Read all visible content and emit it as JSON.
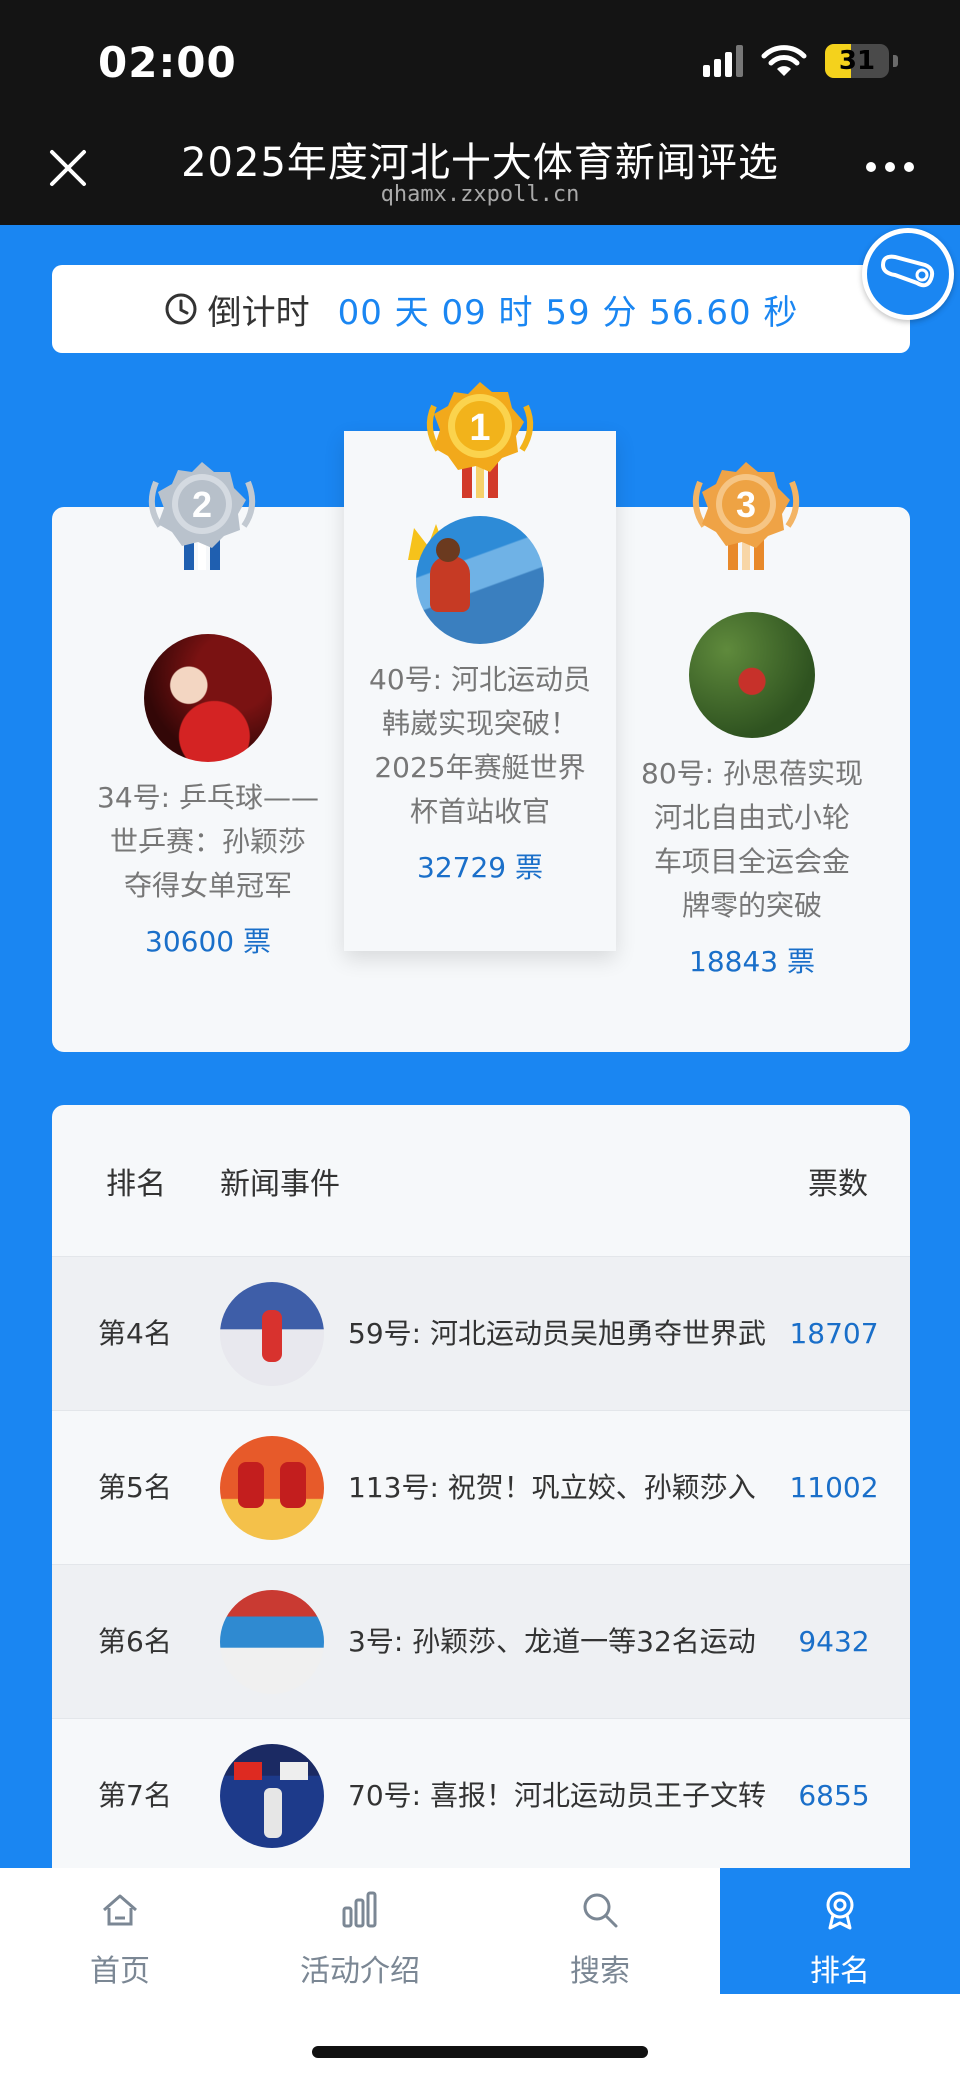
{
  "status_bar": {
    "time": "02:00",
    "battery": "31"
  },
  "header": {
    "title": "2025年度河北十大体育新闻评选",
    "host": "qhamx.zxpoll.cn"
  },
  "countdown": {
    "label": "倒计时",
    "value": "00 天 09 时 59 分 56.60 秒"
  },
  "podium": [
    {
      "place": "2",
      "title_lines": [
        "34号: 乒乓球——",
        "世乒赛：孙颖莎",
        "夺得女单冠军"
      ],
      "votes": "30600 票"
    },
    {
      "place": "1",
      "title_lines": [
        "40号: 河北运动员",
        "韩崴实现突破！",
        "2025年赛艇世界",
        "杯首站收官"
      ],
      "votes": "32729 票"
    },
    {
      "place": "3",
      "title_lines": [
        "80号: 孙思蓓实现",
        "河北自由式小轮",
        "车项目全运会金",
        "牌零的突破"
      ],
      "votes": "18843 票"
    }
  ],
  "ranking": {
    "headers": {
      "rank": "排名",
      "news": "新闻事件",
      "votes": "票数"
    },
    "rows": [
      {
        "rank": "第4名",
        "title": "59号: 河北运动员吴旭勇夺世界武",
        "votes": "18707"
      },
      {
        "rank": "第5名",
        "title": "113号: 祝贺！巩立姣、孙颖莎入",
        "votes": "11002"
      },
      {
        "rank": "第6名",
        "title": "3号: 孙颖莎、龙道一等32名运动",
        "votes": "9432"
      },
      {
        "rank": "第7名",
        "title": "70号: 喜报！河北运动员王子文转",
        "votes": "6855"
      }
    ]
  },
  "tabs": [
    {
      "label": "首页",
      "icon": "home-icon"
    },
    {
      "label": "活动介绍",
      "icon": "bar-chart-icon"
    },
    {
      "label": "搜索",
      "icon": "search-icon"
    },
    {
      "label": "排名",
      "icon": "award-icon",
      "active": true
    }
  ],
  "colors": {
    "accent": "#1a86f2",
    "vote_blue": "#1a6fc9",
    "gold": "#f2b31b",
    "silver": "#a7b0bb",
    "bronze": "#f0a43a"
  }
}
